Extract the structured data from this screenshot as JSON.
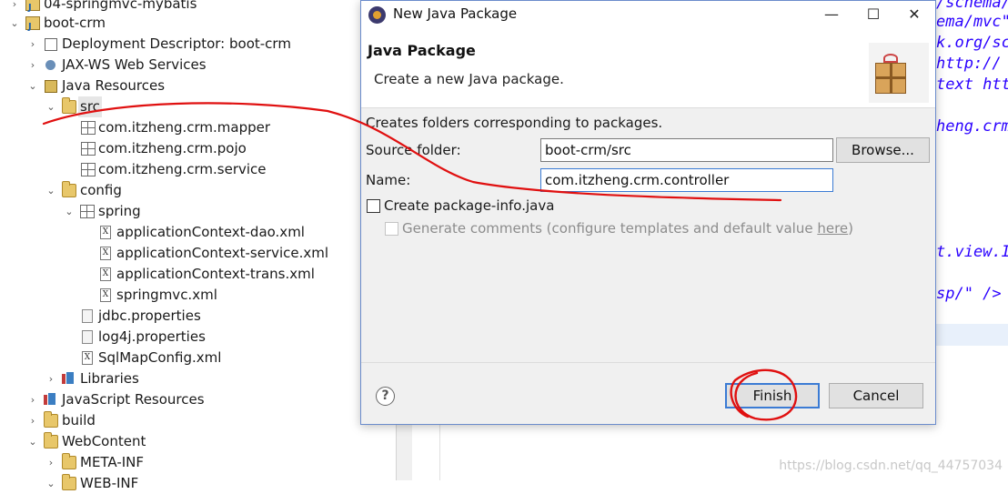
{
  "explorer": {
    "items": [
      {
        "label": "04-springmvc-mybatis",
        "twisty": "›",
        "icon": "project-icon"
      },
      {
        "label": "boot-crm",
        "twisty": "⌄",
        "icon": "project-icon"
      },
      {
        "label": "Deployment Descriptor: boot-crm",
        "twisty": "›",
        "icon": "deployment-descriptor-icon"
      },
      {
        "label": "JAX-WS Web Services",
        "twisty": "›",
        "icon": "web-services-icon"
      },
      {
        "label": "Java Resources",
        "twisty": "⌄",
        "icon": "java-resources-icon"
      },
      {
        "label": "src",
        "twisty": "⌄",
        "icon": "source-folder-icon"
      },
      {
        "label": "com.itzheng.crm.mapper",
        "twisty": "",
        "icon": "package-icon"
      },
      {
        "label": "com.itzheng.crm.pojo",
        "twisty": "",
        "icon": "package-icon"
      },
      {
        "label": "com.itzheng.crm.service",
        "twisty": "",
        "icon": "package-icon"
      },
      {
        "label": "config",
        "twisty": "⌄",
        "icon": "source-folder-icon"
      },
      {
        "label": "spring",
        "twisty": "⌄",
        "icon": "package-icon"
      },
      {
        "label": "applicationContext-dao.xml",
        "twisty": "",
        "icon": "xml-file-icon"
      },
      {
        "label": "applicationContext-service.xml",
        "twisty": "",
        "icon": "xml-file-icon"
      },
      {
        "label": "applicationContext-trans.xml",
        "twisty": "",
        "icon": "xml-file-icon"
      },
      {
        "label": "springmvc.xml",
        "twisty": "",
        "icon": "xml-file-icon"
      },
      {
        "label": "jdbc.properties",
        "twisty": "",
        "icon": "properties-file-icon"
      },
      {
        "label": "log4j.properties",
        "twisty": "",
        "icon": "properties-file-icon"
      },
      {
        "label": "SqlMapConfig.xml",
        "twisty": "",
        "icon": "xml-file-icon"
      },
      {
        "label": "Libraries",
        "twisty": "›",
        "icon": "libraries-icon"
      },
      {
        "label": "JavaScript Resources",
        "twisty": "›",
        "icon": "javascript-resources-icon"
      },
      {
        "label": "build",
        "twisty": "›",
        "icon": "folder-icon"
      },
      {
        "label": "WebContent",
        "twisty": "⌄",
        "icon": "folder-icon"
      },
      {
        "label": "META-INF",
        "twisty": "›",
        "icon": "folder-icon"
      },
      {
        "label": "WEB-INF",
        "twisty": "⌄",
        "icon": "folder-icon"
      }
    ]
  },
  "editor": {
    "lines": [
      "/schema/",
      "ema/mvc\"",
      "k.org/sc",
      " http://",
      "text htt",
      "heng.crm",
      "t.view.I",
      "sp/\" />"
    ]
  },
  "dialog": {
    "title": "New Java Package",
    "minimize": "—",
    "maximize": "☐",
    "close": "✕",
    "heading": "Java Package",
    "description": "Create a new Java package.",
    "intro": "Creates folders corresponding to packages.",
    "source_folder_label": "Source folder:",
    "source_folder_value": "boot-crm/src",
    "browse_label": "Browse...",
    "name_label": "Name:",
    "name_value": "com.itzheng.crm.controller",
    "create_package_info_label": "Create package-info.java",
    "generate_comments_label": "Generate comments (configure templates and default value ",
    "generate_comments_link": "here",
    "generate_comments_suffix": ")",
    "help": "?",
    "finish_label": "Finish",
    "cancel_label": "Cancel"
  },
  "watermark": "https://blog.csdn.net/qq_44757034",
  "colors": {
    "annotation_red": "#e01010",
    "dialog_border": "#6b8ccc",
    "focus_blue": "#3b7bd4",
    "code_blue": "#2a00ff"
  }
}
